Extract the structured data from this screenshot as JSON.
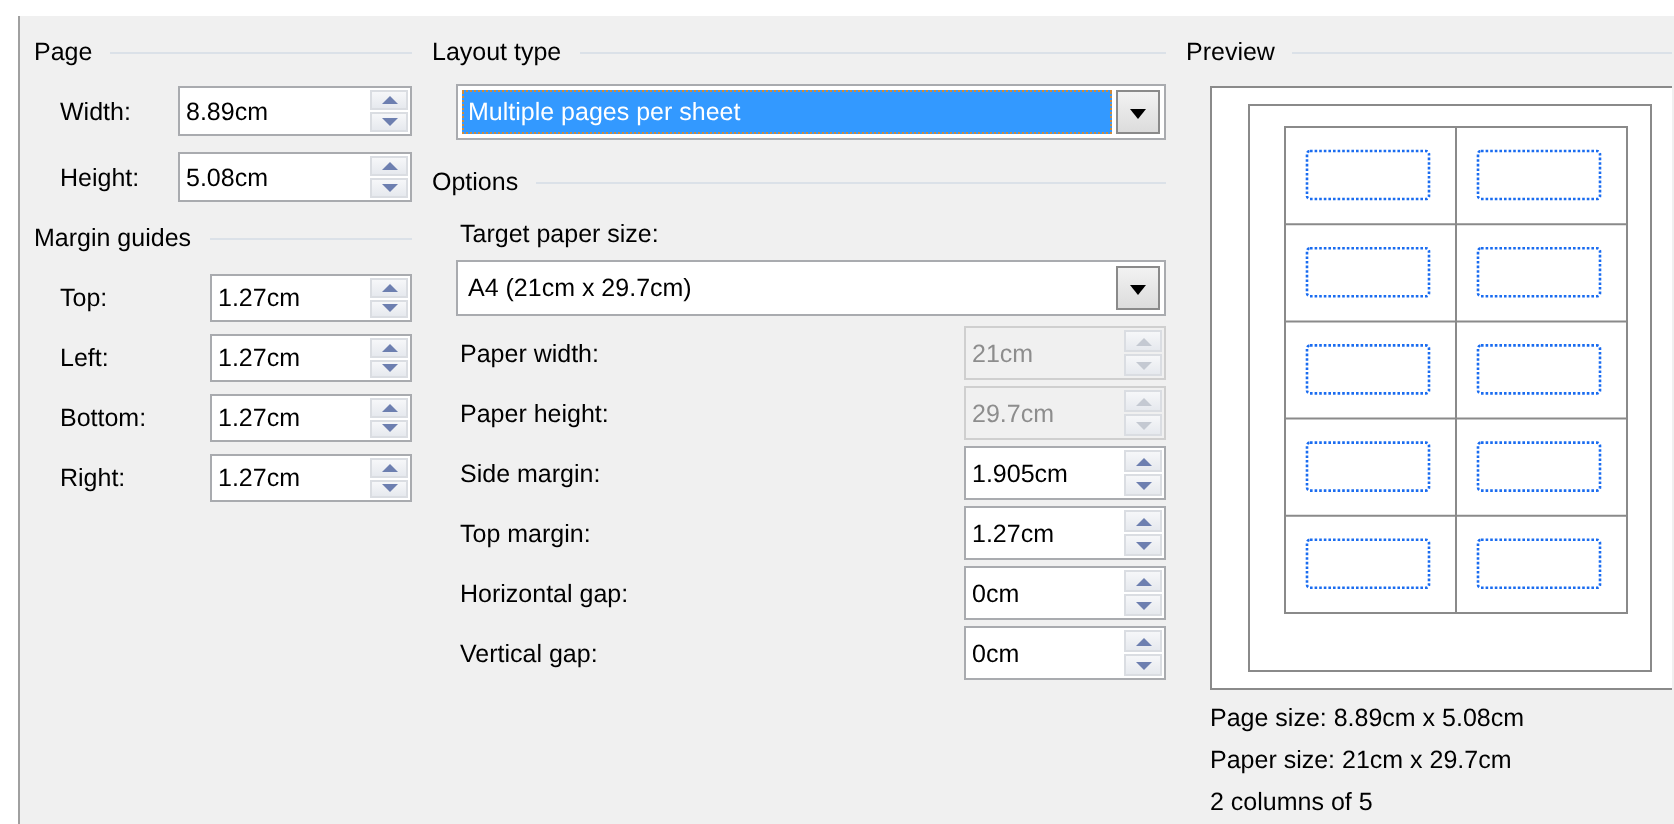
{
  "page": {
    "title": "Page",
    "fields": [
      {
        "label": "Width:",
        "value": "8.89cm",
        "disabled": false
      },
      {
        "label": "Height:",
        "value": "5.08cm",
        "disabled": false
      }
    ]
  },
  "margin_guides": {
    "title": "Margin guides",
    "fields": [
      {
        "label": "Top:",
        "value": "1.27cm",
        "disabled": false
      },
      {
        "label": "Left:",
        "value": "1.27cm",
        "disabled": false
      },
      {
        "label": "Bottom:",
        "value": "1.27cm",
        "disabled": false
      },
      {
        "label": "Right:",
        "value": "1.27cm",
        "disabled": false
      }
    ]
  },
  "layout_type": {
    "title": "Layout type",
    "dropdown": {
      "value": "Multiple pages per sheet",
      "focused": true
    }
  },
  "options": {
    "title": "Options",
    "target_paper_size": {
      "label": "Target paper size:",
      "value": "A4 (21cm x 29.7cm)",
      "focused": false
    },
    "fields": [
      {
        "label": "Paper width:",
        "value": "21cm",
        "disabled": true
      },
      {
        "label": "Paper height:",
        "value": "29.7cm",
        "disabled": true
      },
      {
        "label": "Side margin:",
        "value": "1.905cm",
        "disabled": false
      },
      {
        "label": "Top margin:",
        "value": "1.27cm",
        "disabled": false
      },
      {
        "label": "Horizontal gap:",
        "value": "0cm",
        "disabled": false
      },
      {
        "label": "Vertical gap:",
        "value": "0cm",
        "disabled": false
      }
    ]
  },
  "preview": {
    "title": "Preview",
    "info": [
      "Page size: 8.89cm x 5.08cm",
      "Paper size: 21cm x 29.7cm",
      "2 columns of 5"
    ]
  }
}
